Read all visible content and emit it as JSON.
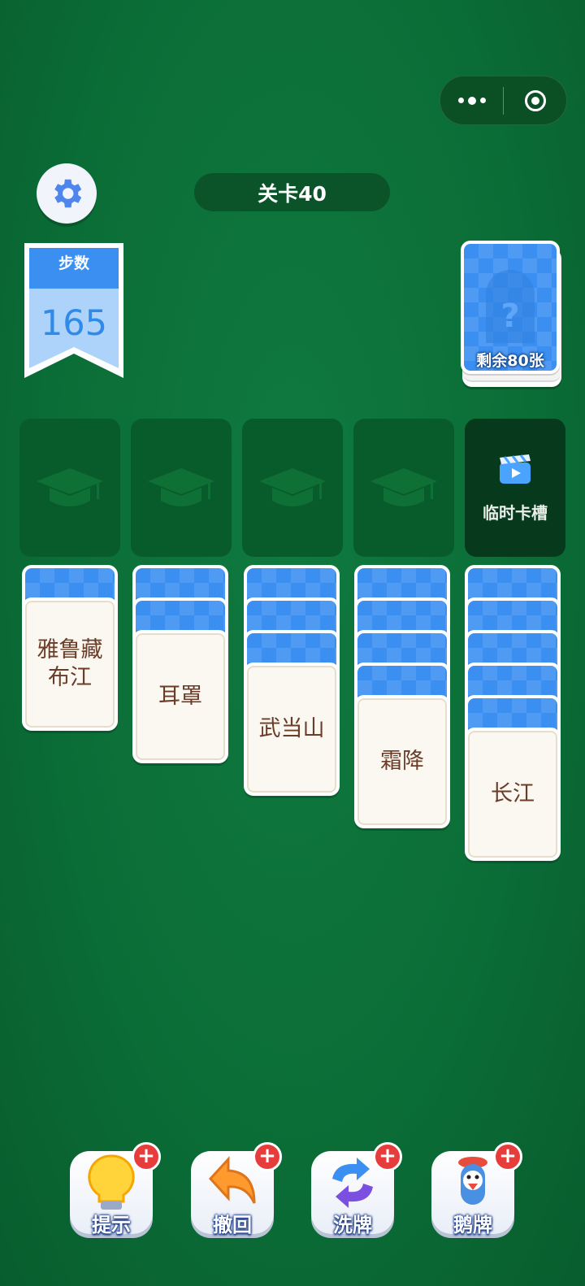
{
  "header": {
    "level_title": "关卡40"
  },
  "capsule": {
    "more_icon": "more-dots-icon",
    "close_icon": "target-circle-icon"
  },
  "steps": {
    "label": "步数",
    "value": "165"
  },
  "deck": {
    "remaining": "剩余80张"
  },
  "slots": [
    {
      "icon": "graduation-cap-icon"
    },
    {
      "icon": "graduation-cap-icon"
    },
    {
      "icon": "graduation-cap-icon"
    },
    {
      "icon": "graduation-cap-icon"
    },
    {
      "icon": "video-clapper-icon",
      "label": "临时卡槽"
    }
  ],
  "columns": [
    {
      "face": "雅鲁藏布江",
      "hidden_count": 1
    },
    {
      "face": "耳罩",
      "hidden_count": 2
    },
    {
      "face": "武当山",
      "hidden_count": 3
    },
    {
      "face": "霜降",
      "hidden_count": 4
    },
    {
      "face": "长江",
      "hidden_count": 5
    }
  ],
  "tools": [
    {
      "label": "提示",
      "icon": "lightbulb-icon"
    },
    {
      "label": "撤回",
      "icon": "undo-arrow-icon"
    },
    {
      "label": "洗牌",
      "icon": "shuffle-arrows-icon"
    },
    {
      "label": "鹅牌",
      "icon": "goose-icon"
    }
  ],
  "colors": {
    "table_green": "#0b6e37",
    "card_blue": "#3b8ff0",
    "card_text": "#6b3c28",
    "plus_red": "#e73c3c"
  }
}
